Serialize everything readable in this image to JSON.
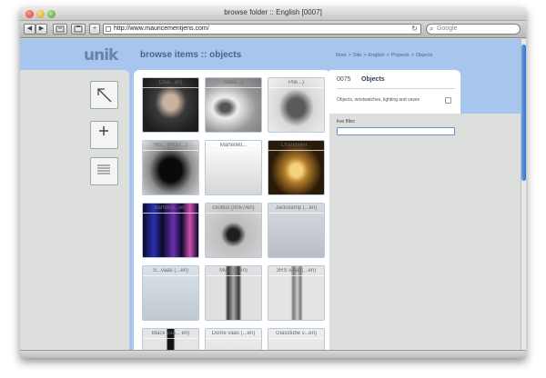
{
  "window": {
    "title": "browse folder :: English [0007]"
  },
  "browser": {
    "url": "http://www.mauricementjens.com/",
    "search_placeholder": "Google",
    "buttons": {
      "back": "◀",
      "forward": "▶",
      "plus": "+"
    }
  },
  "header": {
    "logo": "unik",
    "title": "browse items :: objects",
    "breadcrumb": [
      "Root",
      "Site",
      "English",
      "Projects",
      "Objects"
    ]
  },
  "grid": {
    "items": [
      {
        "label": "Chai...en)"
      },
      {
        "label": "Satur...)"
      },
      {
        "label": "Pile...)"
      },
      {
        "label": "Ho... (0037...)"
      },
      {
        "label": "Martelleti..."
      },
      {
        "label": "Chandelier..."
      },
      {
        "label": "Bamboo...en)"
      },
      {
        "label": "Globus (0057/en)"
      },
      {
        "label": "Jackslamp (...en)"
      },
      {
        "label": "S...vaas (...en)"
      },
      {
        "label": "Mu... (...en)"
      },
      {
        "label": "3RS vase (...en)"
      },
      {
        "label": "Black vaa... en)"
      },
      {
        "label": "Dome vaas (...en)"
      },
      {
        "label": "Glasstube v...en)"
      }
    ]
  },
  "info": {
    "id": "0075",
    "title": "Objects",
    "description": "Objects, wristwatches, lighting and vases"
  },
  "filter": {
    "label": "live filter",
    "value": ""
  }
}
